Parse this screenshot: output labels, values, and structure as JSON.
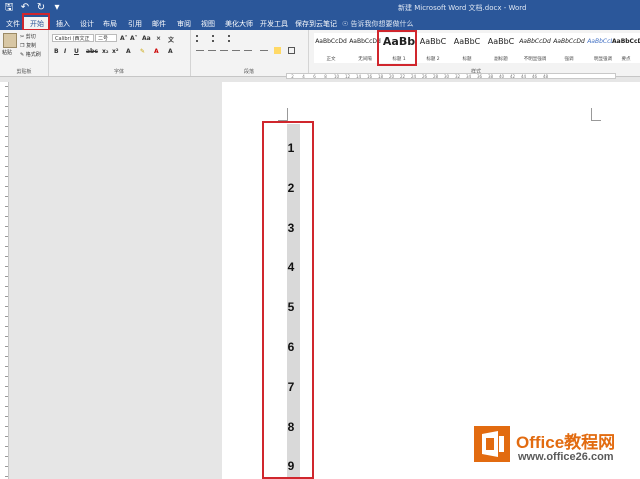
{
  "titlebar": {
    "title": "新建 Microsoft Word 文档.docx - Word",
    "qat": {
      "save_icon": "save-icon",
      "undo_icon": "undo-icon",
      "redo_icon": "redo-icon"
    }
  },
  "menu": {
    "file": "文件",
    "home": "开始",
    "insert": "插入",
    "design": "设计",
    "layout": "布局",
    "references": "引用",
    "mailings": "邮件",
    "review": "审阅",
    "view": "视图",
    "meihua": "美化大师",
    "developer": "开发工具",
    "save_cloud": "保存到云笔记",
    "tell_me": "告诉我你想要做什么"
  },
  "clipboard": {
    "paste": "粘贴",
    "cut": "剪切",
    "copy": "复制",
    "format_painter": "格式刷",
    "group": "剪贴板"
  },
  "font": {
    "name": "Calibri (西文正",
    "size": "二号",
    "group": "字体"
  },
  "paragraph": {
    "group": "段落"
  },
  "styles": {
    "group": "样式",
    "items": [
      {
        "sample": "AaBbCcDd",
        "name": "正文"
      },
      {
        "sample": "AaBbCcDd",
        "name": "无间隔"
      },
      {
        "sample": "AaBb",
        "name": "标题 1"
      },
      {
        "sample": "AaBbC",
        "name": "标题 2"
      },
      {
        "sample": "AaBbC",
        "name": "标题"
      },
      {
        "sample": "AaBbC",
        "name": "副标题"
      },
      {
        "sample": "AaBbCcDd",
        "name": "不明显强调"
      },
      {
        "sample": "AaBbCcDd",
        "name": "强调"
      },
      {
        "sample": "AaBbCcDd",
        "name": "明显强调"
      },
      {
        "sample": "AaBbCcDd",
        "name": "要点"
      }
    ]
  },
  "ruler": {
    "ticks": [
      "2",
      "4",
      "6",
      "8",
      "10",
      "12",
      "14",
      "16",
      "18",
      "20",
      "22",
      "24",
      "26",
      "28",
      "30",
      "32",
      "34",
      "36",
      "38",
      "40",
      "42",
      "44",
      "46",
      "48"
    ]
  },
  "document": {
    "numbers": [
      "1",
      "2",
      "3",
      "4",
      "5",
      "6",
      "7",
      "8",
      "9"
    ]
  },
  "watermark": {
    "brand": "Office教程网",
    "url": "www.office26.com"
  },
  "colors": {
    "accent": "#2b579a",
    "highlight": "#d0262d",
    "logo_orange": "#e26b10"
  }
}
